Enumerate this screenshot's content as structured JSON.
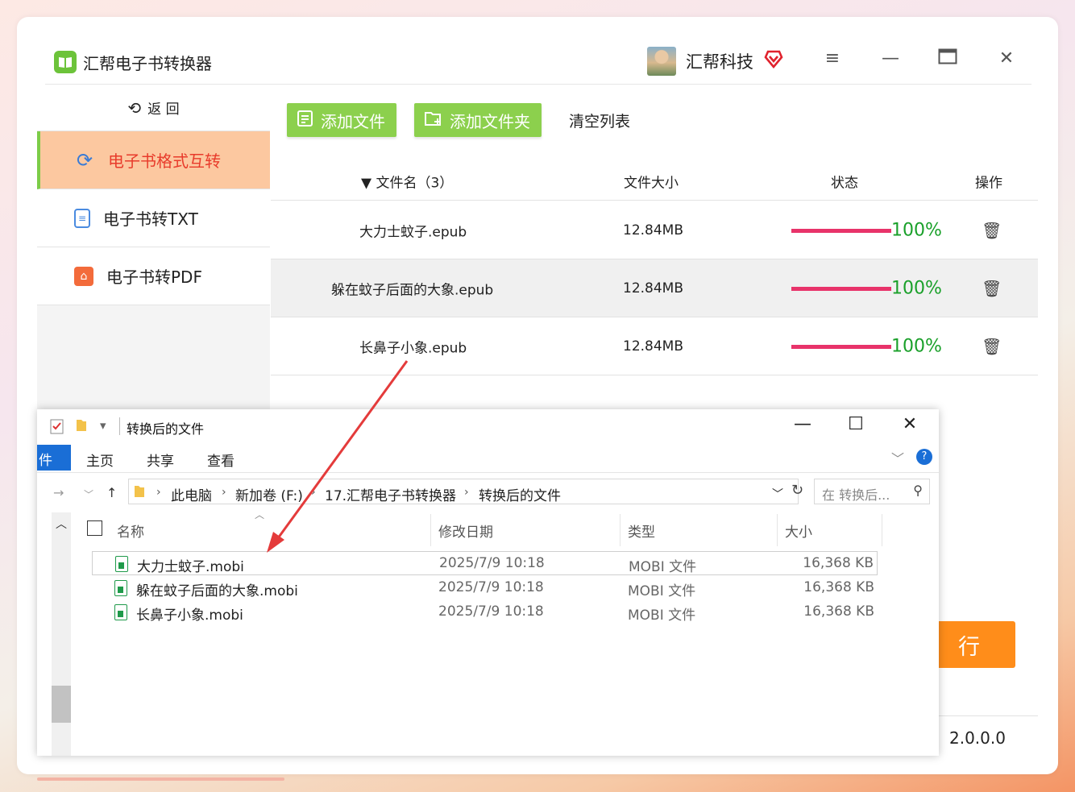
{
  "app": {
    "title": "汇帮电子书转换器",
    "logo_glyph": "▯▯",
    "user_name": "汇帮科技",
    "version_prefix": "：",
    "version": "2.0.0.0",
    "accent_color": "#8cd04d",
    "active_bg": "#fcc8a0",
    "progress_color": "#e8336a",
    "progress_text_color": "#1aa02a",
    "execute_label": "执行",
    "execute_visible": "行"
  },
  "window_controls": {
    "menu": "≡",
    "minimize": "—",
    "maximize": "▭",
    "close": "✕"
  },
  "sidebar": {
    "back_label": "返 回",
    "items": [
      {
        "label": "电子书格式互转",
        "icon": "refresh-icon",
        "glyph": "⟳",
        "active": true
      },
      {
        "label": "电子书转TXT",
        "icon": "txt-doc-icon",
        "glyph": "≡",
        "active": false
      },
      {
        "label": "电子书转PDF",
        "icon": "pdf-icon",
        "glyph": "⌂",
        "active": false
      }
    ]
  },
  "toolbar": {
    "add_file": "添加文件",
    "add_folder": "添加文件夹",
    "clear_list": "清空列表"
  },
  "table": {
    "headers": {
      "name": "文件名（3）",
      "size": "文件大小",
      "status": "状态",
      "action": "操作"
    },
    "rows": [
      {
        "name": "大力士蚊子.epub",
        "size": "12.84MB",
        "progress": 1.0,
        "progress_text": "100%"
      },
      {
        "name": "躲在蚊子后面的大象.epub",
        "size": "12.84MB",
        "progress": 1.0,
        "progress_text": "100%"
      },
      {
        "name": "长鼻子小象.epub",
        "size": "12.84MB",
        "progress": 1.0,
        "progress_text": "100%"
      }
    ]
  },
  "explorer": {
    "title": "转换后的文件",
    "window_controls": {
      "minimize": "—",
      "maximize": "☐",
      "close": "✕"
    },
    "ribbon": {
      "file_tab": "件",
      "home": "主页",
      "share": "共享",
      "view": "查看",
      "help": "?"
    },
    "address": [
      "此电脑",
      "新加卷 (F:)",
      "17.汇帮电子书转换器",
      "转换后的文件"
    ],
    "search_placeholder": "在 转换后...",
    "columns": {
      "name": "名称",
      "modified": "修改日期",
      "type": "类型",
      "size": "大小"
    },
    "files": [
      {
        "name": "大力士蚊子.mobi",
        "modified": "2025/7/9 10:18",
        "type": "MOBI 文件",
        "size": "16,368 KB",
        "selected": true
      },
      {
        "name": "躲在蚊子后面的大象.mobi",
        "modified": "2025/7/9 10:18",
        "type": "MOBI 文件",
        "size": "16,368 KB",
        "selected": false
      },
      {
        "name": "长鼻子小象.mobi",
        "modified": "2025/7/9 10:18",
        "type": "MOBI 文件",
        "size": "16,368 KB",
        "selected": false
      }
    ]
  }
}
